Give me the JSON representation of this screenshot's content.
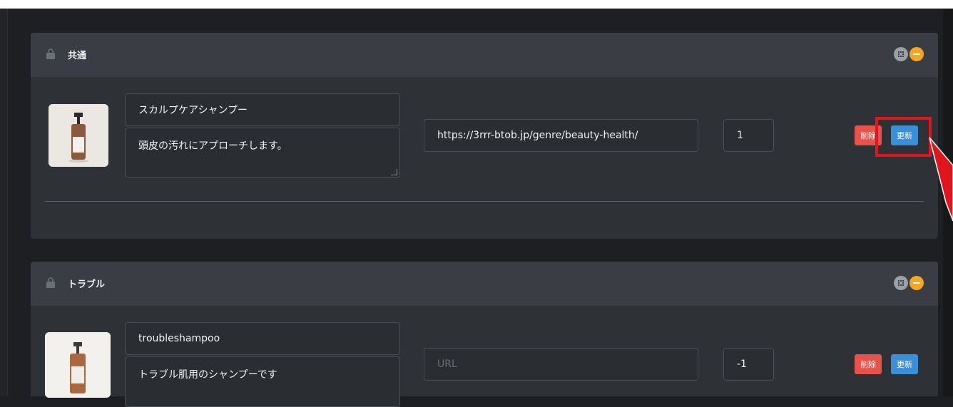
{
  "panels": [
    {
      "title": "共通",
      "item": {
        "name": "スカルプケアシャンプー",
        "description": "頭皮の汚れにアプローチします。",
        "url": "https://3rrr-btob.jp/genre/beauty-health/",
        "url_placeholder": "URL",
        "order": "1",
        "delete_label": "削除",
        "update_label": "更新"
      }
    },
    {
      "title": "トラブル",
      "item": {
        "name": "troubleshampoo",
        "description": "トラブル肌用のシャンプーです",
        "url": "",
        "url_placeholder": "URL",
        "order": "-1",
        "delete_label": "削除",
        "update_label": "更新"
      }
    }
  ],
  "colors": {
    "background": "#1e1f22",
    "panel": "#2e3136",
    "panel_header": "#3a3e44",
    "delete": "#e5534b",
    "update": "#3b8fd9",
    "collapse": "#f5a623",
    "highlight": "#e0161e"
  },
  "icons": [
    "bag-icon",
    "expand-icon",
    "collapse-icon",
    "resize-grip-icon",
    "arrow-pointer"
  ]
}
